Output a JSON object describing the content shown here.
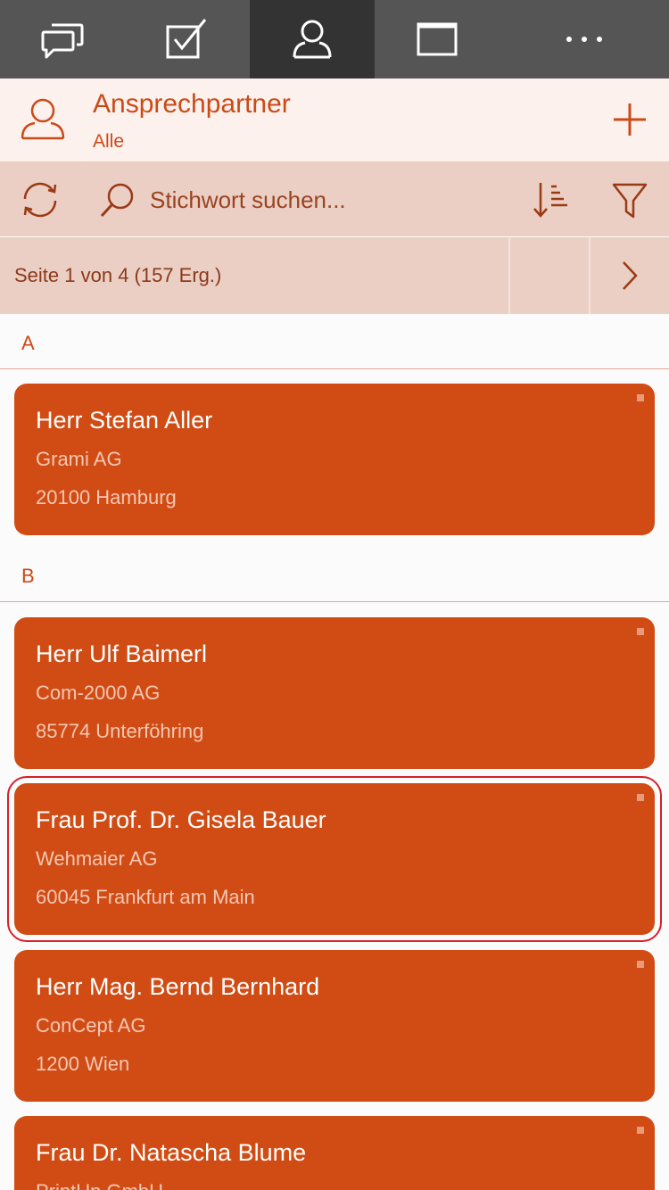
{
  "tabs": [
    {
      "icon": "chat-icon"
    },
    {
      "icon": "checkbox-icon"
    },
    {
      "icon": "contact-icon",
      "active": true
    },
    {
      "icon": "window-icon"
    },
    {
      "icon": "more-icon"
    }
  ],
  "header": {
    "title": "Ansprechpartner",
    "subtitle": "Alle",
    "add_icon": "plus-icon"
  },
  "search": {
    "placeholder": "Stichwort suchen...",
    "value": ""
  },
  "pager": {
    "info": "Seite 1 von 4 (157 Erg.)"
  },
  "sections": [
    {
      "letter": "A",
      "contacts": [
        {
          "salutation": "Herr",
          "name": "Stefan Aller",
          "company": "Grami AG",
          "city": "20100 Hamburg"
        }
      ]
    },
    {
      "letter": "B",
      "contacts": [
        {
          "salutation": "Herr",
          "name": "Ulf Baimerl",
          "company": "Com-2000 AG",
          "city": "85774 Unterföhring"
        },
        {
          "salutation": "Frau Prof. Dr.",
          "name": "Gisela Bauer",
          "company": "Wehmaier AG",
          "city": "60045 Frankfurt am Main",
          "selected": true
        },
        {
          "salutation": "Herr Mag.",
          "name": "Bernd Bernhard",
          "company": "ConCept AG",
          "city": "1200 Wien"
        },
        {
          "salutation": "Frau Dr.",
          "name": "Natascha Blume",
          "company": "PrintUp GmbH",
          "city": ""
        }
      ]
    }
  ],
  "colors": {
    "accent": "#d14c14",
    "tabbar": "#555555",
    "tab_active": "#333333",
    "toolbar": "#ebcec4",
    "header": "#fdf1ee",
    "selection": "#d81f2a"
  }
}
